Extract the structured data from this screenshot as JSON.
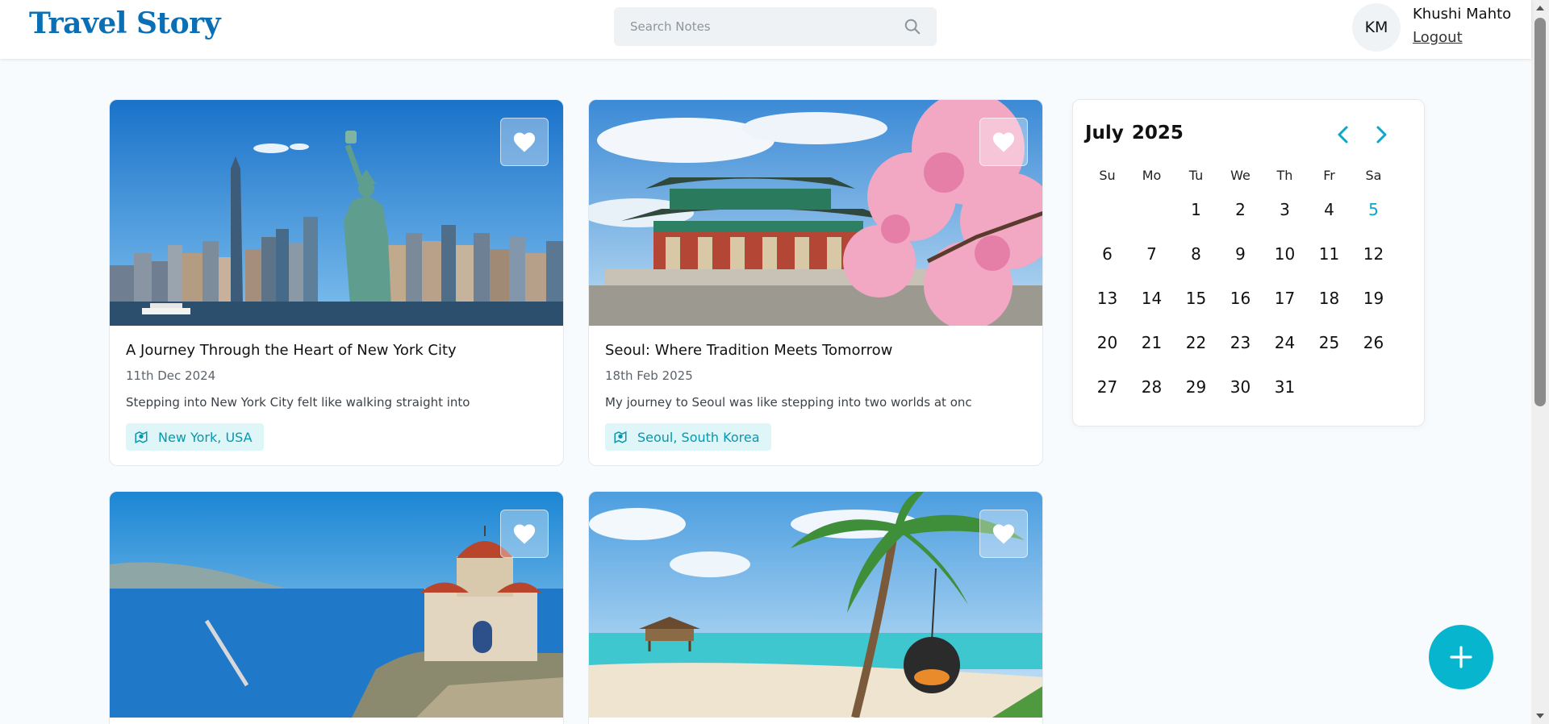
{
  "app": {
    "logo": "Travel Story",
    "brand_color": "#0a6fb5",
    "accent_color": "#07b5cf"
  },
  "search": {
    "placeholder": "Search Notes",
    "value": "",
    "icon": "search-icon"
  },
  "user": {
    "initials": "KM",
    "name": "Khushi Mahto",
    "logout_label": "Logout"
  },
  "stories": [
    {
      "title": "A Journey Through the Heart of New York City",
      "date": "11th Dec 2024",
      "excerpt": "Stepping into New York City felt like walking straight into",
      "location": "New York, USA",
      "favorite_icon": "heart-icon",
      "image": "Statue of Liberty with Manhattan skyline"
    },
    {
      "title": "Seoul: Where Tradition Meets Tomorrow",
      "date": "18th Feb 2025",
      "excerpt": "My journey to Seoul was like stepping into two worlds at onc",
      "location": "Seoul, South Korea",
      "favorite_icon": "heart-icon",
      "image": "Korean palace with cherry blossoms"
    },
    {
      "favorite_icon": "heart-icon",
      "image": "Greek island church above blue sea"
    },
    {
      "favorite_icon": "heart-icon",
      "image": "Tropical beach with palm tree and hanging swing chair"
    }
  ],
  "calendar": {
    "month": "July",
    "year": "2025",
    "weekdays": [
      "Su",
      "Mo",
      "Tu",
      "We",
      "Th",
      "Fr",
      "Sa"
    ],
    "weeks": [
      [
        "",
        "",
        "1",
        "2",
        "3",
        "4",
        "5"
      ],
      [
        "6",
        "7",
        "8",
        "9",
        "10",
        "11",
        "12"
      ],
      [
        "13",
        "14",
        "15",
        "16",
        "17",
        "18",
        "19"
      ],
      [
        "20",
        "21",
        "22",
        "23",
        "24",
        "25",
        "26"
      ],
      [
        "27",
        "28",
        "29",
        "30",
        "31",
        "",
        ""
      ]
    ],
    "highlighted_day": "5",
    "highlight_color": "#0aa8c8",
    "prev_icon": "chevron-left-icon",
    "next_icon": "chevron-right-icon"
  },
  "fab": {
    "icon": "plus-icon"
  }
}
